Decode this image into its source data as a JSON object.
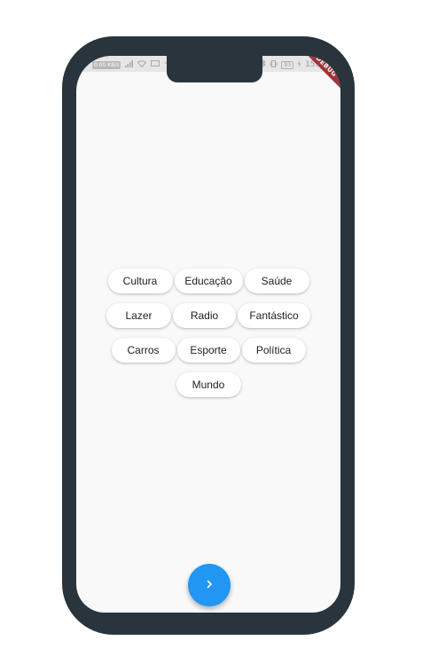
{
  "statusbar": {
    "left_badge": "0.00\nKB/s",
    "time": "15:08",
    "battery": "93"
  },
  "debug_banner": "DEBUG",
  "chips": [
    [
      "Cultura",
      "Educação",
      "Saúde"
    ],
    [
      "Lazer",
      "Radio",
      "Fantástico"
    ],
    [
      "Carros",
      "Esporte",
      "Política"
    ],
    [
      "Mundo"
    ]
  ],
  "fab": {
    "icon": "chevron-right-icon",
    "color": "#2196f3"
  },
  "colors": {
    "phone_frame": "#29343c",
    "screen_bg": "#f9f9f9",
    "banner": "#a2333a"
  }
}
